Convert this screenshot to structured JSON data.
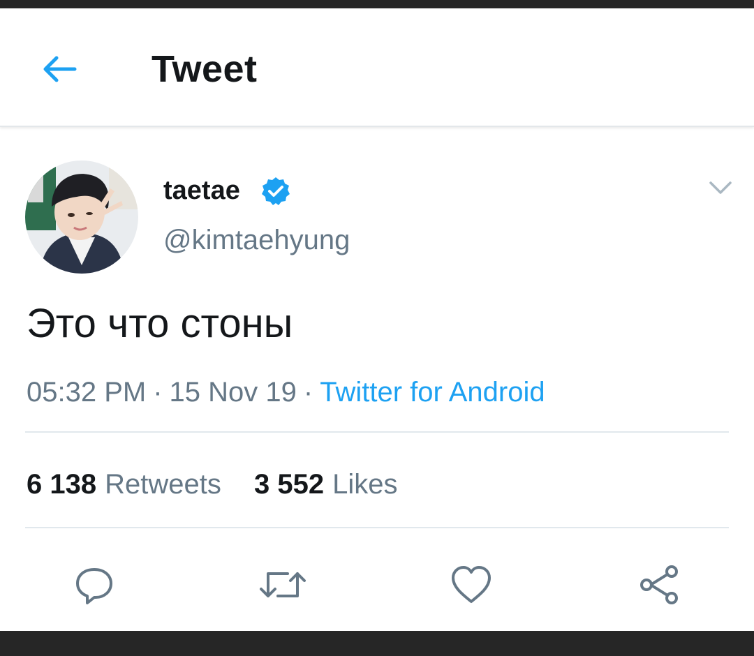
{
  "header": {
    "title": "Tweet",
    "back_icon": "back-arrow-icon",
    "accent": "#1da1f2"
  },
  "author": {
    "display_name": "taetae",
    "handle": "@kimtaehyung",
    "verified": true,
    "verified_icon": "verified-badge-icon"
  },
  "tweet": {
    "text": "Это что стоны",
    "time": "05:32 PM",
    "date": "15 Nov 19",
    "separator": "·",
    "source": "Twitter for Android"
  },
  "stats": {
    "retweets_count": "6 138",
    "retweets_label": "Retweets",
    "likes_count": "3 552",
    "likes_label": "Likes"
  },
  "actions": [
    {
      "name": "reply",
      "icon": "reply-icon"
    },
    {
      "name": "retweet",
      "icon": "retweet-icon"
    },
    {
      "name": "like",
      "icon": "heart-icon"
    },
    {
      "name": "share",
      "icon": "share-icon"
    }
  ],
  "colors": {
    "text_primary": "#14171a",
    "text_secondary": "#657786",
    "link": "#1da1f2",
    "divider": "#e1e8ed",
    "icon_gray": "#657786"
  }
}
